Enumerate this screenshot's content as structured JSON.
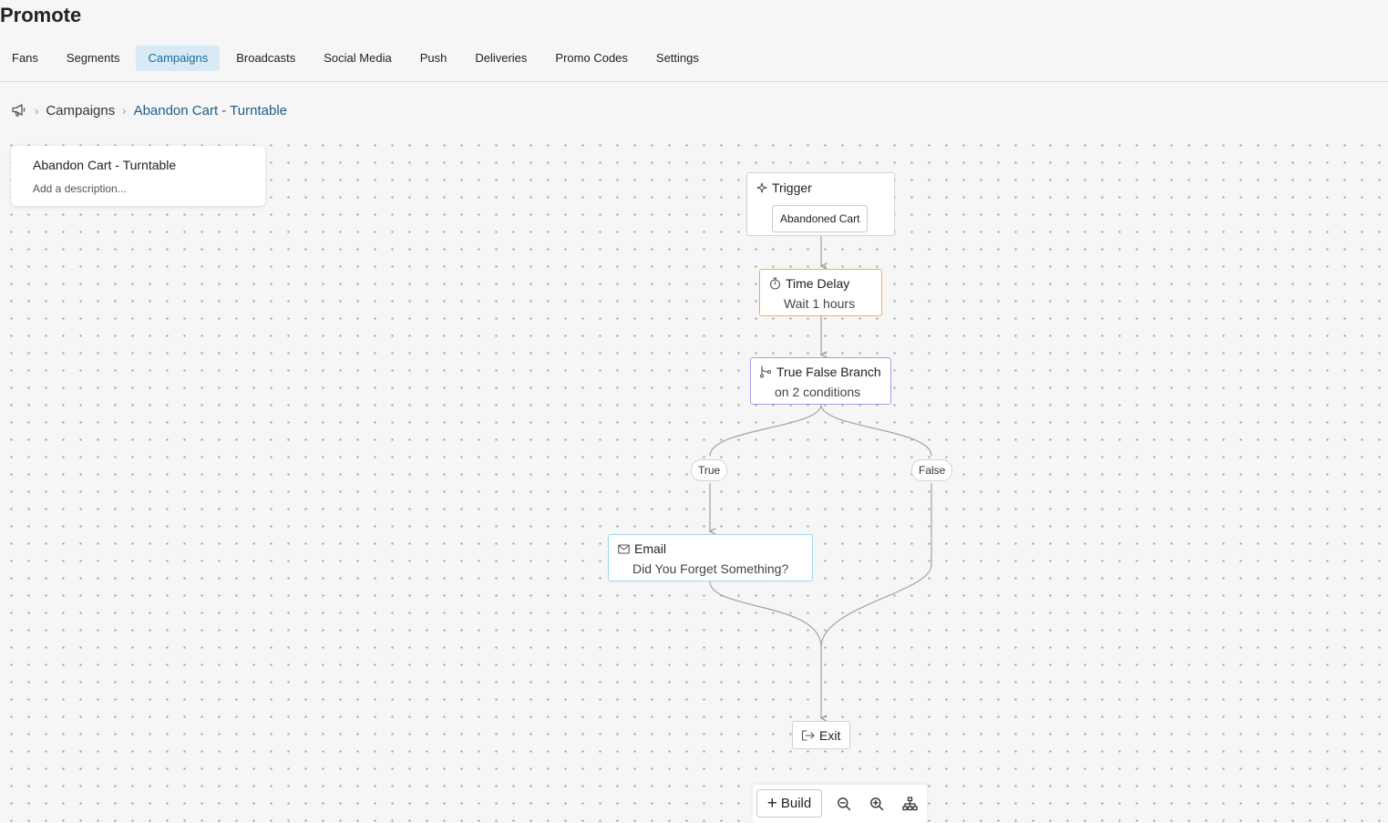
{
  "app": {
    "title": "Promote"
  },
  "tabs": [
    {
      "label": "Fans"
    },
    {
      "label": "Segments"
    },
    {
      "label": "Campaigns",
      "active": true
    },
    {
      "label": "Broadcasts"
    },
    {
      "label": "Social Media"
    },
    {
      "label": "Push"
    },
    {
      "label": "Deliveries"
    },
    {
      "label": "Promo Codes"
    },
    {
      "label": "Settings"
    }
  ],
  "breadcrumb": {
    "icon": "megaphone-icon",
    "items": [
      "Campaigns",
      "Abandon Cart - Turntable"
    ]
  },
  "campaign": {
    "name": "Abandon Cart - Turntable",
    "description_placeholder": "Add a description..."
  },
  "flow": {
    "trigger": {
      "icon": "sparkle-icon",
      "title": "Trigger",
      "value": "Abandoned Cart"
    },
    "time_delay": {
      "icon": "stopwatch-icon",
      "title": "Time Delay",
      "subtitle": "Wait 1 hours",
      "color": "#f0b042"
    },
    "branch": {
      "icon": "branch-icon",
      "title": "True False Branch",
      "subtitle": "on 2 conditions",
      "color": "#a79ce0"
    },
    "branch_labels": {
      "true": "True",
      "false": "False"
    },
    "email": {
      "icon": "envelope-icon",
      "title": "Email",
      "subtitle": "Did You Forget Something?",
      "color": "#9fd6f0"
    },
    "exit": {
      "icon": "exit-icon",
      "title": "Exit"
    }
  },
  "toolbar": {
    "build_label": "Build",
    "icons": [
      "zoom-out-icon",
      "zoom-in-icon",
      "auto-layout-icon"
    ]
  },
  "colors": {
    "active_tab_bg": "#d8eaf6",
    "link": "#1a5e87"
  }
}
